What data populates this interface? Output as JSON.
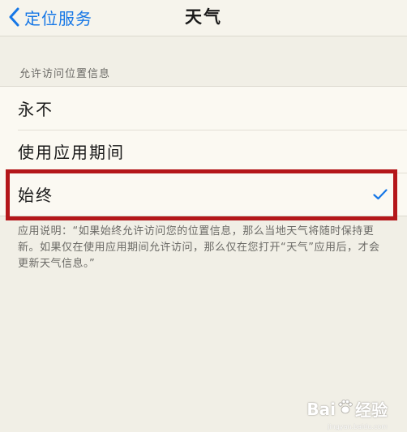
{
  "navbar": {
    "back_label": "定位服务",
    "title": "天气"
  },
  "section": {
    "header": "允许访问位置信息",
    "options": [
      "永不",
      "使用应用期间",
      "始终"
    ],
    "selected_index": 2
  },
  "note": "应用说明：“如果始终允许访问您的位置信息，那么当地天气将随时保持更新。如果仅在使用应用期间允许访问，那么仅在您打开“天气”应用后，才会更新天气信息。”",
  "watermark": {
    "brand": "Bai",
    "suffix": "经验",
    "url": "jingyan.baidu.com"
  },
  "colors": {
    "accent": "#1677e6",
    "highlight": "#b4171a"
  }
}
